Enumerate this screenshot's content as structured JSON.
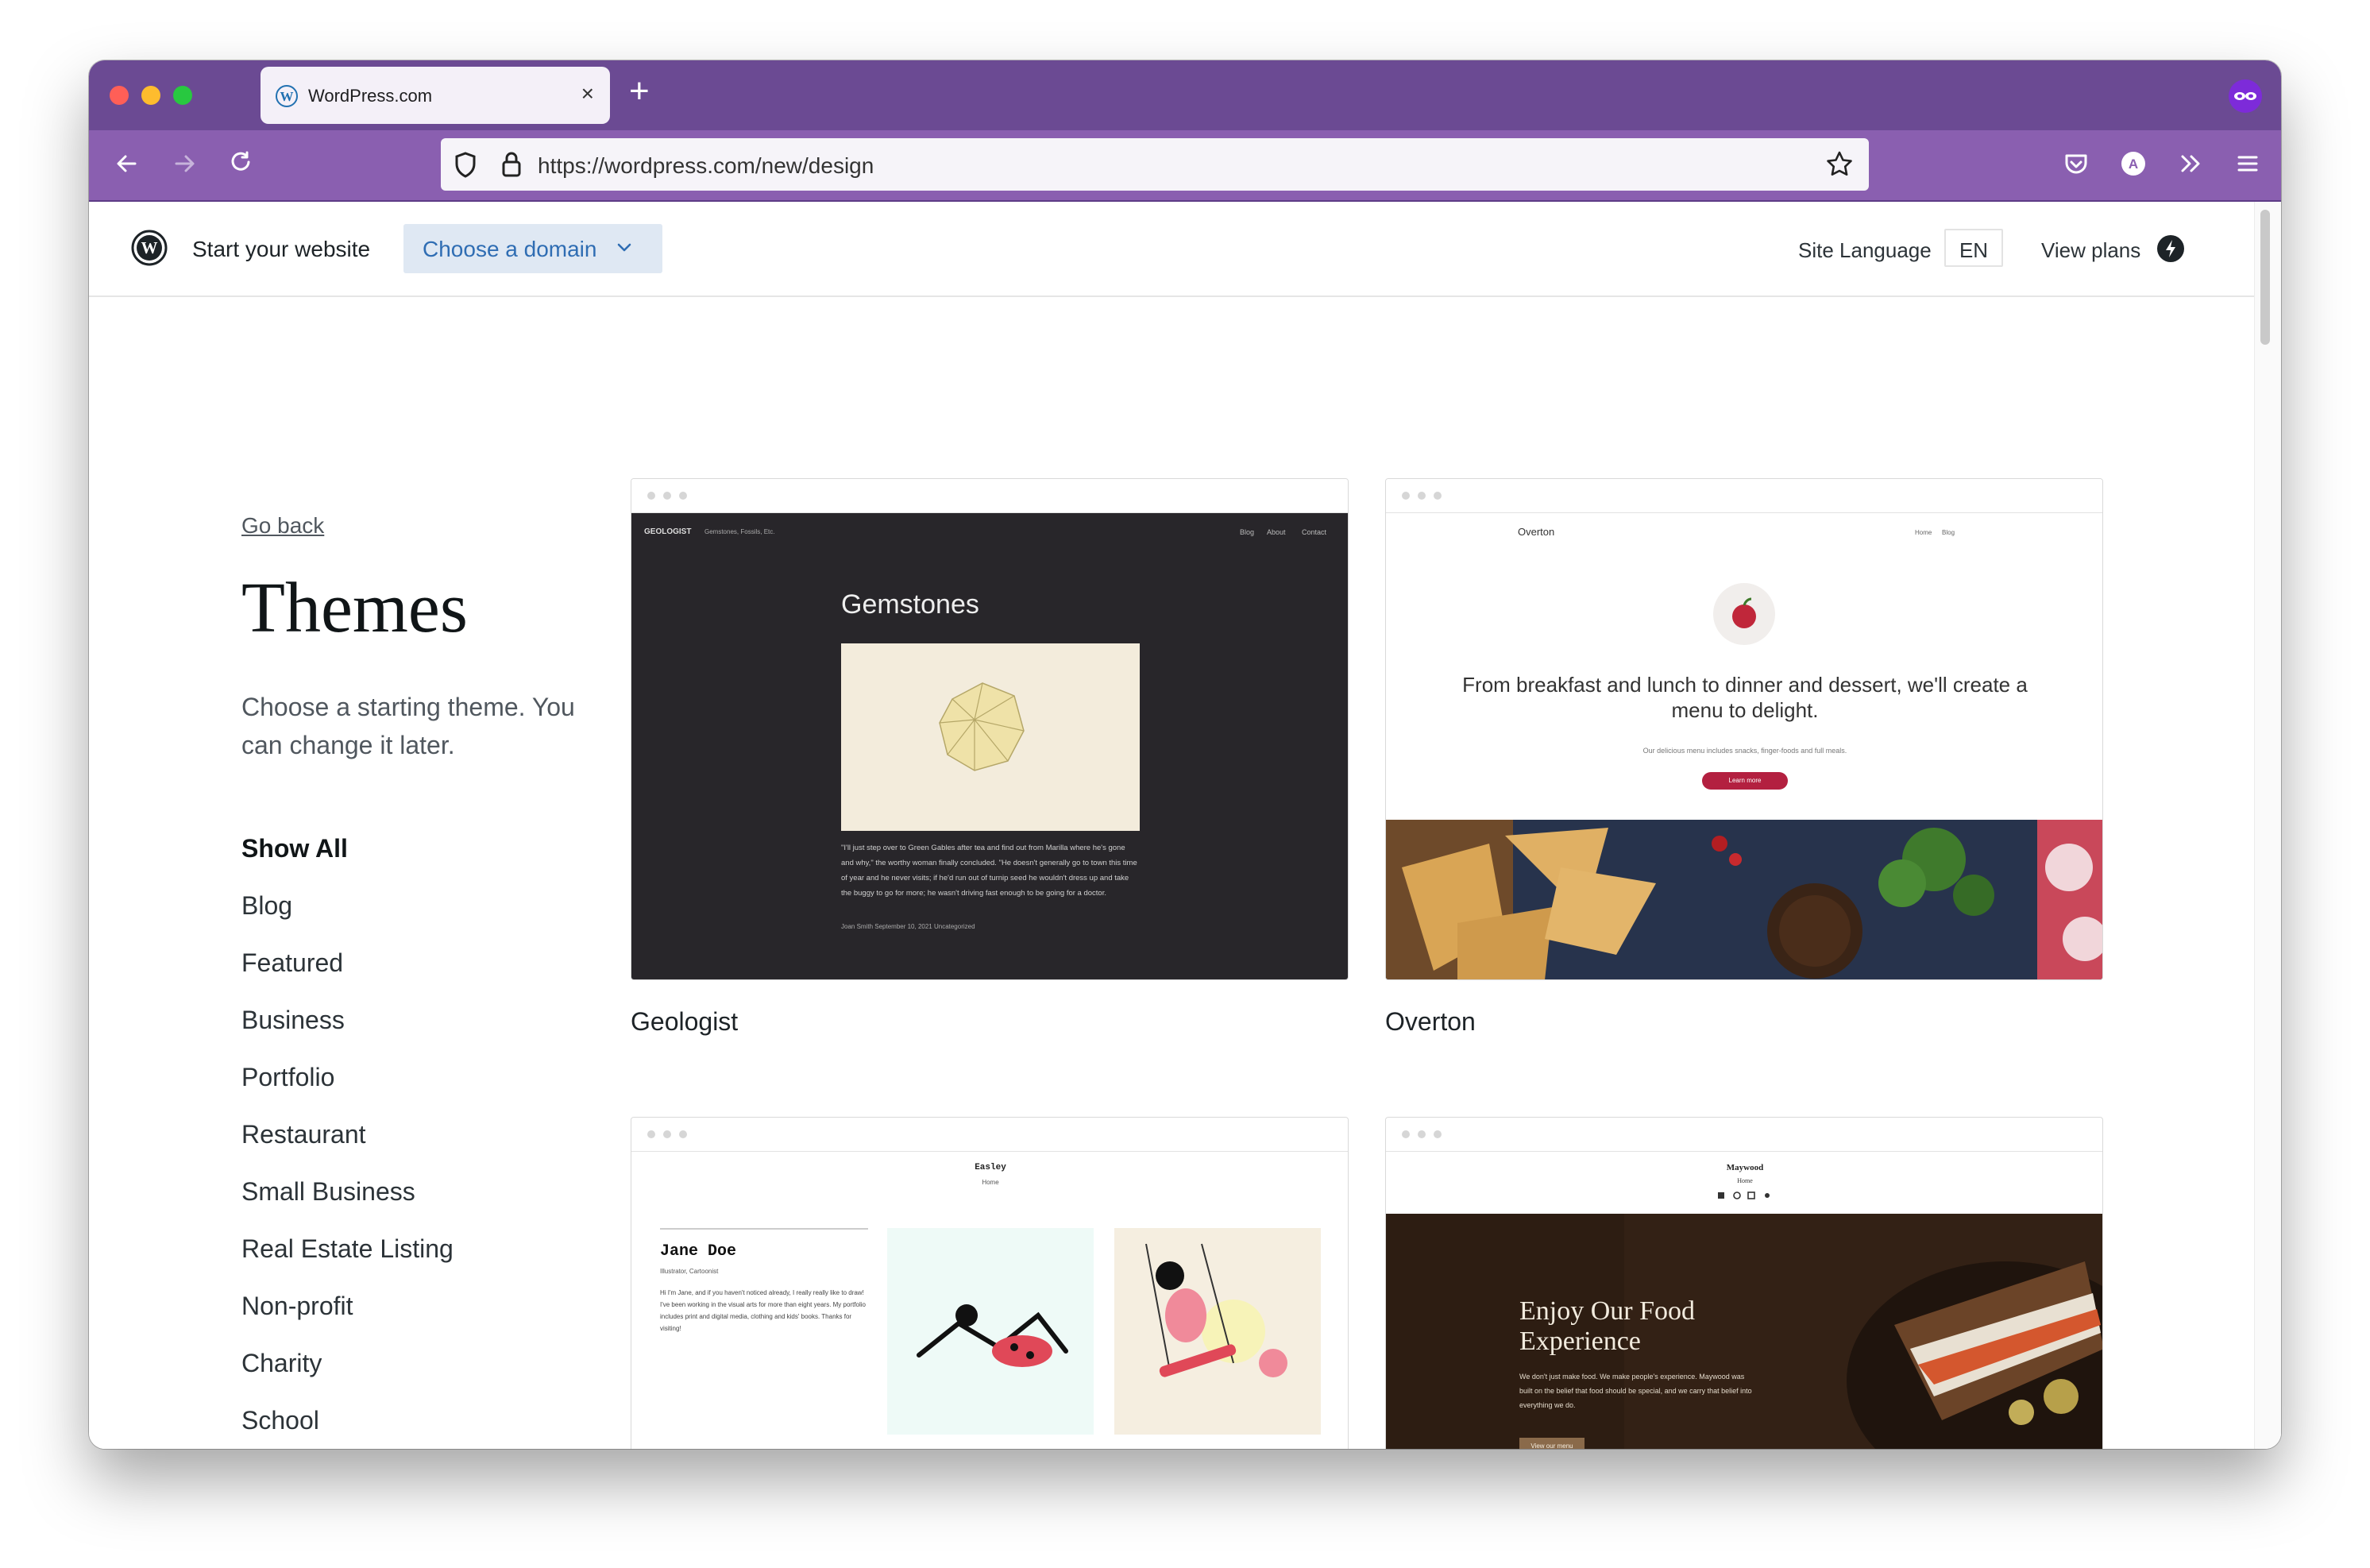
{
  "browser": {
    "tab_title": "WordPress.com",
    "url": "https://wordpress.com/new/design",
    "traffic_colors": [
      "#ff5f57",
      "#febc2e",
      "#28c840"
    ],
    "accent": "#6b4a93"
  },
  "header": {
    "start_label": "Start your website",
    "domain_label": "Choose a domain",
    "site_language_label": "Site Language",
    "site_language_value": "EN",
    "view_plans_label": "View plans"
  },
  "sidebar": {
    "go_back": "Go back",
    "title": "Themes",
    "subtitle": "Choose a starting theme. You can change it later.",
    "categories": [
      {
        "label": "Show All",
        "active": true
      },
      {
        "label": "Blog"
      },
      {
        "label": "Featured"
      },
      {
        "label": "Business"
      },
      {
        "label": "Portfolio"
      },
      {
        "label": "Restaurant"
      },
      {
        "label": "Small Business"
      },
      {
        "label": "Real Estate Listing"
      },
      {
        "label": "Non-profit"
      },
      {
        "label": "Charity"
      },
      {
        "label": "School"
      }
    ]
  },
  "themes": [
    {
      "name": "Geologist",
      "preview": {
        "site_name": "GEOLOGIST",
        "tagline": "Gemstones, Fossils, Etc.",
        "nav": [
          "Blog",
          "About",
          "Contact"
        ],
        "post_title": "Gemstones",
        "excerpt": "\"I'll just step over to Green Gables after tea and find out from Marilla where he's gone and why,\" the worthy woman finally concluded. \"He doesn't generally go to town this time of year and he never visits; if he'd run out of turnip seed he wouldn't dress up and take the buggy to go for more; he wasn't driving fast enough to be going for a doctor.",
        "meta": "Joan Smith   September 10, 2021   Uncategorized"
      }
    },
    {
      "name": "Overton",
      "preview": {
        "site_name": "Overton",
        "nav": [
          "Home",
          "Blog"
        ],
        "headline": "From breakfast and lunch to dinner and dessert, we'll create a menu to delight.",
        "small": "Our delicious menu includes snacks, finger-foods and full meals.",
        "button": "Learn more"
      }
    },
    {
      "name": "Easley",
      "preview": {
        "site_name": "Easley",
        "nav": "Home",
        "author": "Jane Doe",
        "role": "Illustrator, Cartoonist",
        "bio": "Hi I'm Jane, and if you haven't noticed already, I really really like to draw! I've been working in the visual arts for more than eight years. My portfolio includes print and digital media, clothing and kids' books. Thanks for visiting!"
      }
    },
    {
      "name": "Maywood",
      "preview": {
        "site_name": "Maywood",
        "nav": "Home",
        "headline": "Enjoy Our Food Experience",
        "body": "We don't just make food. We make people's experience. Maywood was built on the belief that food should be special, and we carry that belief into everything we do.",
        "button": "View our menu"
      }
    }
  ]
}
